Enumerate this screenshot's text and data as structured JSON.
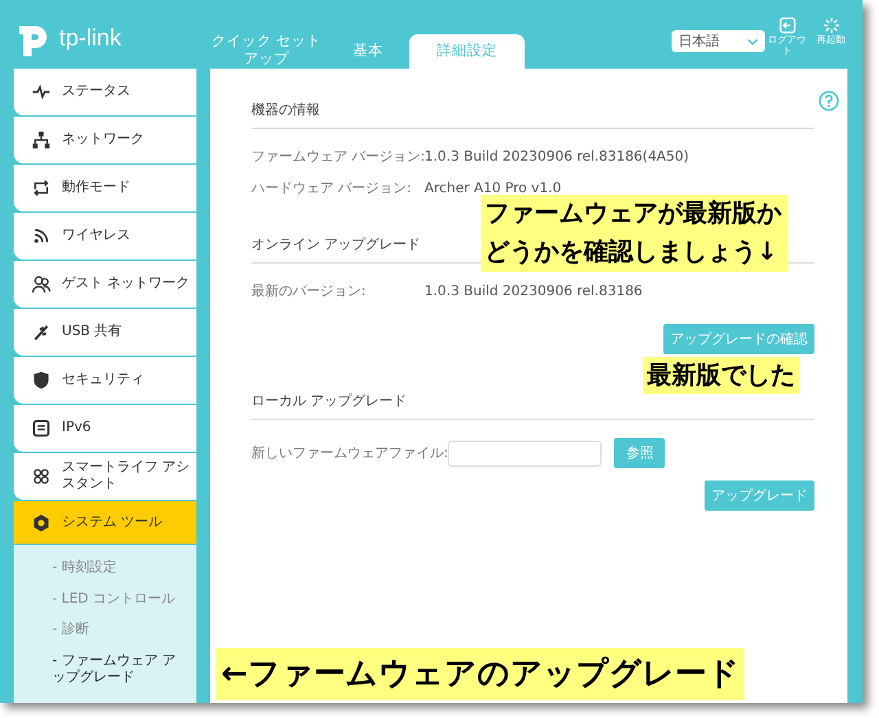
{
  "header": {
    "logo": "tp-link",
    "tabs": [
      {
        "label": "クイック セットアップ",
        "selected": false
      },
      {
        "label": "基本",
        "selected": false
      },
      {
        "label": "詳細設定",
        "selected": true
      }
    ],
    "language": "日本語",
    "actions": [
      {
        "kind": "logout",
        "label": "ログアウト"
      },
      {
        "kind": "reboot",
        "label": "再起動"
      }
    ]
  },
  "sidebar": {
    "items": [
      {
        "label": "ステータス",
        "selected": false
      },
      {
        "label": "ネットワーク",
        "selected": false
      },
      {
        "label": "動作モード",
        "selected": false
      },
      {
        "label": "ワイヤレス",
        "selected": false
      },
      {
        "label": "ゲスト ネットワーク",
        "selected": false
      },
      {
        "label": "USB 共有",
        "selected": false
      },
      {
        "label": "セキュリティ",
        "selected": false
      },
      {
        "label": "IPv6",
        "selected": false
      },
      {
        "label": "スマートライフ アシスタント",
        "selected": false
      },
      {
        "label": "システム ツール",
        "selected": true,
        "children": [
          {
            "label": "- 時刻設定",
            "selected": false
          },
          {
            "label": "- LED コントロール",
            "selected": false
          },
          {
            "label": "- 診断",
            "selected": false
          },
          {
            "label": "- ファームウェア アップグレード",
            "selected": true
          }
        ]
      }
    ]
  },
  "content": {
    "sections": [
      {
        "title": "機器の情報",
        "rows": [
          {
            "label": "ファームウェア バージョン:",
            "value": "1.0.3 Build 20230906 rel.83186(4A50)"
          },
          {
            "label": "ハードウェア バージョン:",
            "value": "Archer A10 Pro v1.0"
          }
        ]
      },
      {
        "title": "オンライン アップグレード",
        "rows": [
          {
            "label": "最新のバージョン:",
            "value": "1.0.3 Build 20230906 rel.83186"
          }
        ],
        "button": "アップグレードの確認"
      },
      {
        "title": "ローカル アップグレード",
        "file": {
          "label": "新しいファームウェアファイル:",
          "browse": "参照"
        },
        "button": "アップグレード"
      }
    ]
  },
  "annotations": [
    {
      "kind": "check",
      "text": "ファームウェアが最新版かどうかを確認しましょう↓"
    },
    {
      "kind": "latest",
      "text": "最新版でした"
    },
    {
      "kind": "upgrade",
      "text": "←ファームウェアのアップグレード"
    }
  ]
}
